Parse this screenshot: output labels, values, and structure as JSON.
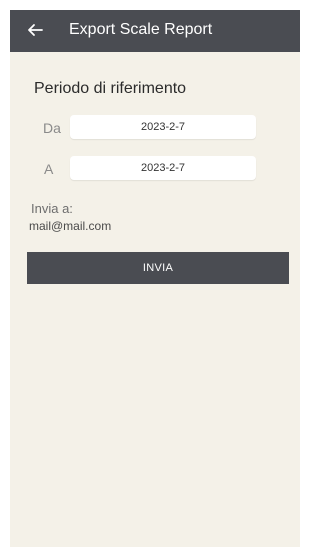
{
  "appbar": {
    "title": "Export Scale Report",
    "back_icon": "arrow-left-icon"
  },
  "form": {
    "section_title": "Periodo di riferimento",
    "from_label": "Da",
    "from_value": "2023-2-7",
    "to_label": "A",
    "to_value": "2023-2-7",
    "send_to_label": "Invia a:",
    "email": "mail@mail.com",
    "submit_label": "INVIA"
  },
  "colors": {
    "appbar_bg": "#4a4c52",
    "content_bg": "#f4f1e8",
    "button_bg": "#4a4c52"
  }
}
